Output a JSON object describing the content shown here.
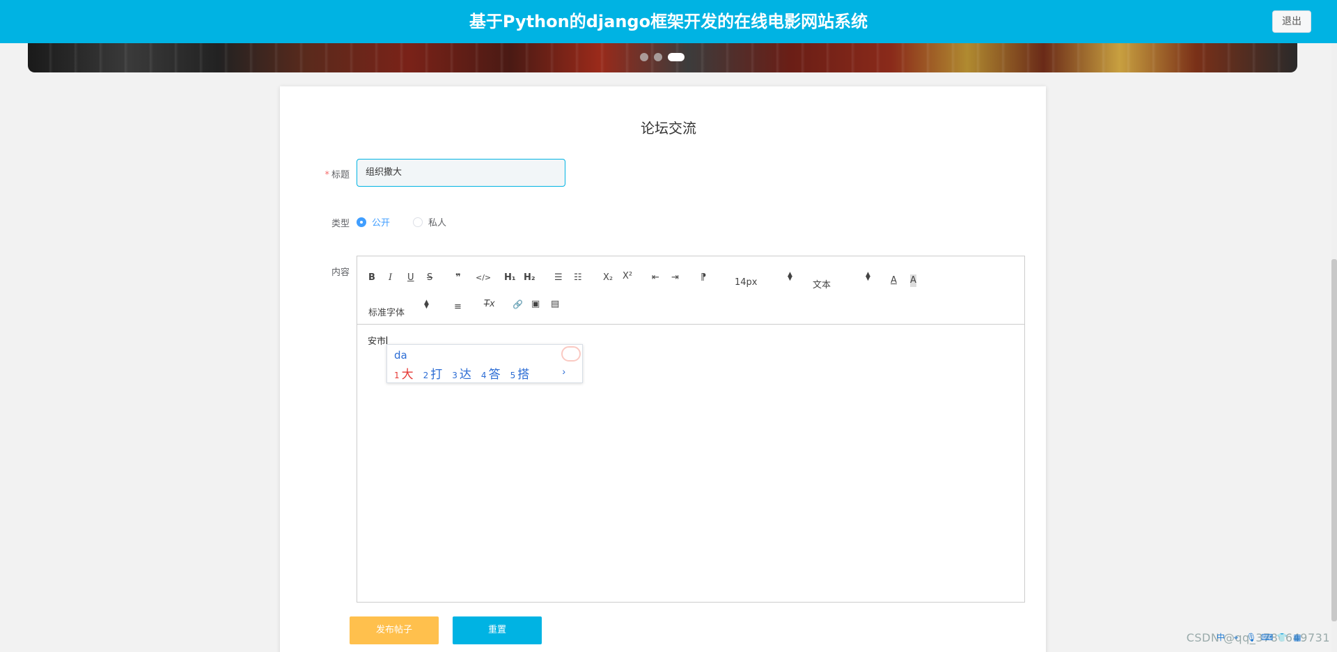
{
  "header": {
    "title": "基于Python的django框架开发的在线电影网站系统",
    "logout_label": "退出"
  },
  "banner": {
    "slides": 3,
    "active_slide": 3
  },
  "form": {
    "heading": "论坛交流",
    "title_label": "标题",
    "title_required_mark": "*",
    "title_value": "组织撒大",
    "type_label": "类型",
    "type_options": [
      "公开",
      "私人"
    ],
    "type_selected": "公开",
    "content_label": "内容",
    "content_text": "安市",
    "publish_label": "发布帖子",
    "reset_label": "重置"
  },
  "editor": {
    "toolbar": {
      "bold": "B",
      "italic": "I",
      "underline": "U",
      "strike": "S",
      "quote": "❞",
      "code": "</>",
      "h1": "H₁",
      "h2": "H₂",
      "ordered_list": "☰",
      "bullet_list": "☷",
      "subscript": "X₂",
      "superscript": "X²",
      "outdent": "⇤",
      "indent": "⇥",
      "direction": "⁋",
      "font_size": "14px",
      "header_select": "文本",
      "font_color": "A",
      "background_color": "A",
      "font_family": "标准字体",
      "align": "≡",
      "clean": "T̶x",
      "link": "🔗",
      "image": "▣",
      "video": "▤"
    }
  },
  "ime": {
    "composition": "da",
    "candidates": [
      {
        "num": "1",
        "text": "大"
      },
      {
        "num": "2",
        "text": "打"
      },
      {
        "num": "3",
        "text": "达"
      },
      {
        "num": "4",
        "text": "答"
      },
      {
        "num": "5",
        "text": "搭"
      }
    ],
    "next": "›"
  },
  "watermark": "CSDN @qq_3786649731",
  "tray_icons": [
    "中",
    "⌖",
    "🎙",
    "⌨",
    "👕",
    "▦"
  ],
  "colors": {
    "header": "#00b3e3",
    "publish": "#ffc04d",
    "reset": "#00b3e3",
    "radio_checked": "#409eff",
    "required": "#f56c6c"
  }
}
